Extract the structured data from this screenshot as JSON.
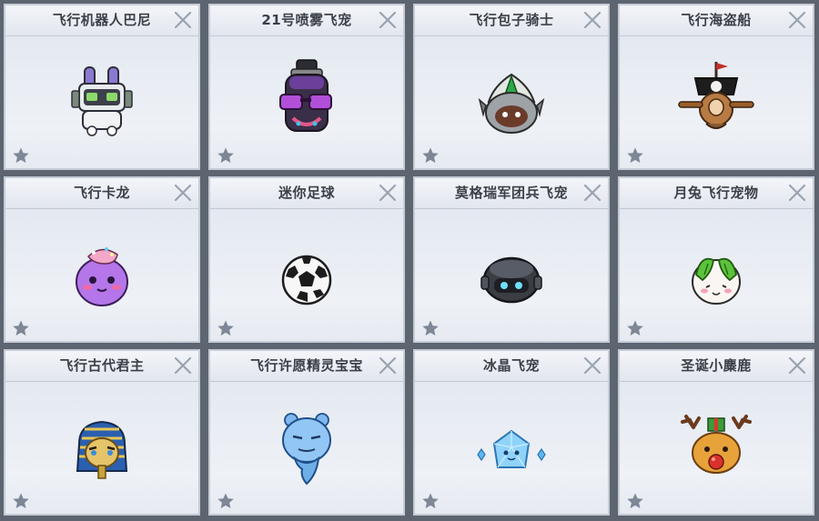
{
  "pets": [
    {
      "name": "飞行机器人巴尼",
      "icon": "robot-pet-icon"
    },
    {
      "name": "21号喷雾飞宠",
      "icon": "spray-can-pet-icon"
    },
    {
      "name": "飞行包子骑士",
      "icon": "bun-knight-pet-icon"
    },
    {
      "name": "飞行海盗船",
      "icon": "pirate-ship-pet-icon"
    },
    {
      "name": "飞行卡龙",
      "icon": "macaron-pet-icon"
    },
    {
      "name": "迷你足球",
      "icon": "soccer-ball-pet-icon"
    },
    {
      "name": "莫格瑞军团兵飞宠",
      "icon": "legion-soldier-pet-icon"
    },
    {
      "name": "月兔飞行宠物",
      "icon": "moon-rabbit-pet-icon"
    },
    {
      "name": "飞行古代君主",
      "icon": "pharaoh-pet-icon"
    },
    {
      "name": "飞行许愿精灵宝宝",
      "icon": "wish-genie-pet-icon"
    },
    {
      "name": "冰晶飞宠",
      "icon": "ice-crystal-pet-icon"
    },
    {
      "name": "圣诞小麋鹿",
      "icon": "christmas-reindeer-pet-icon"
    }
  ],
  "colors": {
    "background": "#5c6570",
    "card": "#e8ecf3",
    "title": "#3b3f47",
    "star": "#7d8796"
  }
}
